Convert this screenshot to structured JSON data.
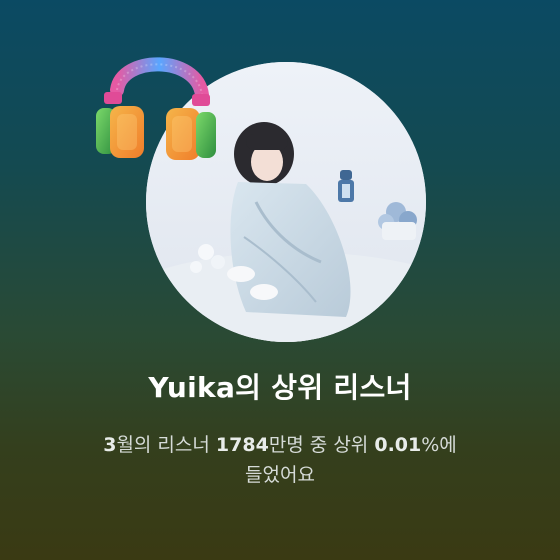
{
  "artist": "Yuika",
  "title_suffix": "의 상위 리스너",
  "month_text": "3",
  "month_unit": "월의 리스너 ",
  "listeners": "1784",
  "listeners_unit": "만명 중 상위 ",
  "percent": "0.01",
  "percent_suffix": "%에",
  "line2": "들었어요",
  "icons": {
    "headphones": "headphones-icon",
    "photo": "artist-photo"
  },
  "colors": {
    "background_top": "#0b4a63",
    "background_bottom": "#3a3a13",
    "title": "#ffffff",
    "text": "#d6dbd8"
  }
}
